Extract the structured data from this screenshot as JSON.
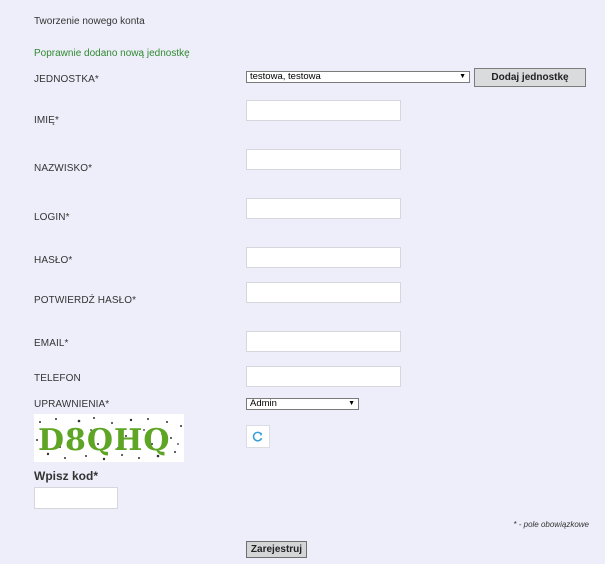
{
  "page": {
    "title": "Tworzenie nowego konta",
    "success_message": "Poprawnie dodano nową jednostkę"
  },
  "form": {
    "unit": {
      "label": "JEDNOSTKA*",
      "selected": "testowa, testowa",
      "add_button": "Dodaj jednostkę"
    },
    "first_name": {
      "label": "IMIĘ*",
      "value": ""
    },
    "last_name": {
      "label": "NAZWISKO*",
      "value": ""
    },
    "login": {
      "label": "LOGIN*",
      "value": ""
    },
    "password": {
      "label": "HASŁO*",
      "value": ""
    },
    "confirm_password": {
      "label": "POTWIERDŹ HASŁO*",
      "value": ""
    },
    "email": {
      "label": "EMAIL*",
      "value": ""
    },
    "phone": {
      "label": "TELEFON",
      "value": ""
    },
    "permissions": {
      "label": "UPRAWNIENIA*",
      "selected": "Admin"
    },
    "captcha": {
      "text": "D8QHQ",
      "code_label": "Wpisz kod*",
      "value": ""
    },
    "required_note": "* - pole obowiązkowe",
    "submit_button": "Zarejestruj"
  },
  "icons": {
    "refresh": "refresh-icon",
    "dropdown": "caret-down-icon"
  },
  "colors": {
    "background": "#eeeefb",
    "success": "#2f8a2f",
    "captcha_text": "#5fa525"
  }
}
